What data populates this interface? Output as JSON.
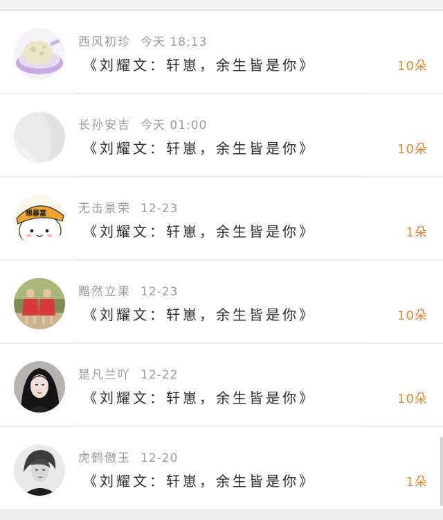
{
  "comments": [
    {
      "username": "西风初珍",
      "time": "今天 18:13",
      "message": "《刘耀文：轩崽，余生皆是你》",
      "count": "10朵",
      "avatar_icon": "bowl-avatar-icon"
    },
    {
      "username": "长孙安吉",
      "time": "今天 01:00",
      "message": "《刘耀文：轩崽，余生皆是你》",
      "count": "10朵",
      "avatar_icon": "blank-avatar-icon"
    },
    {
      "username": "无击景荣",
      "time": "12-23",
      "message": "《刘耀文：轩崽，余生皆是你》",
      "count": "1朵",
      "avatar_icon": "cartoon-helmet-avatar-icon",
      "avatar_text": "想暴富"
    },
    {
      "username": "黯然立果",
      "time": "12-23",
      "message": "《刘耀文：轩崽，余生皆是你》",
      "count": "10朵",
      "avatar_icon": "girls-photo-avatar-icon"
    },
    {
      "username": "是凡兰吖",
      "time": "12-22",
      "message": "《刘耀文：轩崽，余生皆是你》",
      "count": "10朵",
      "avatar_icon": "portrait-avatar-icon"
    },
    {
      "username": "虎鹤傲玉",
      "time": "12-20",
      "message": "《刘耀文：轩崽，余生皆是你》",
      "count": "1朵",
      "avatar_icon": "bw-portrait-avatar-icon"
    }
  ],
  "colors": {
    "count": "#e8842d",
    "username": "#9b9b9b",
    "message": "#2b2b2b",
    "background": "#ececec"
  }
}
